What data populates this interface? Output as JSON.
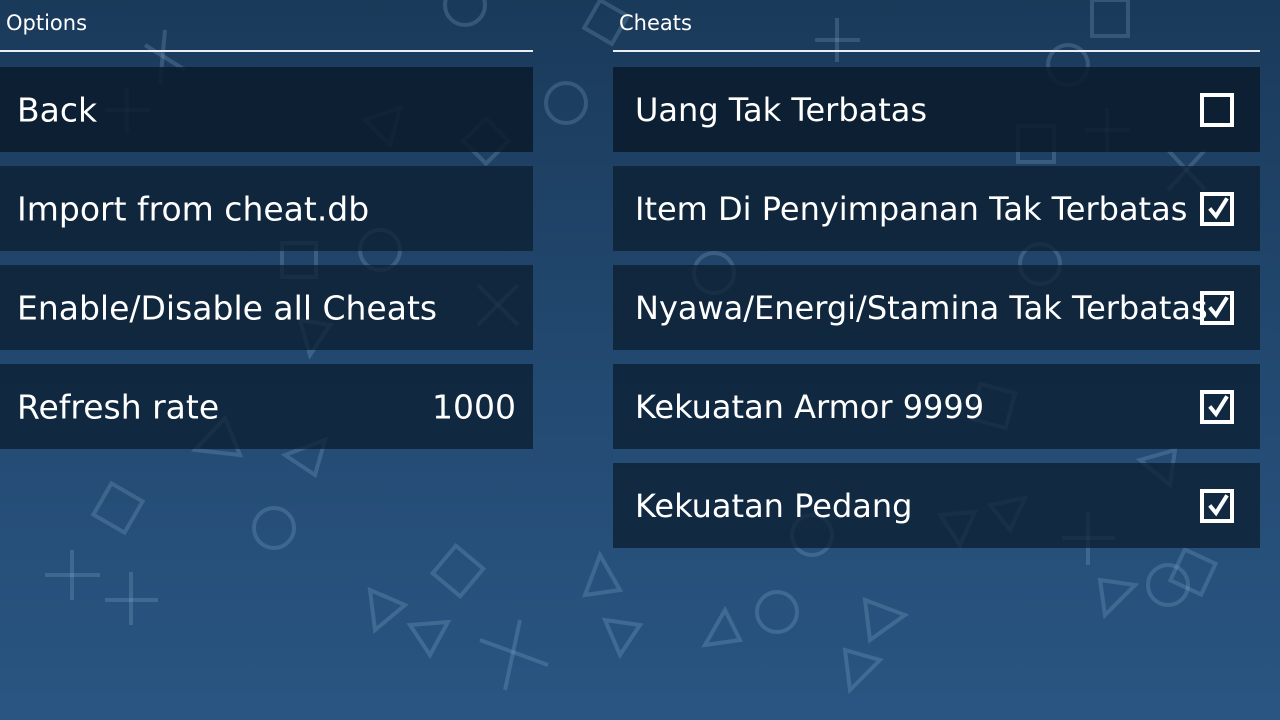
{
  "options": {
    "header": "Options",
    "items": [
      {
        "label": "Back"
      },
      {
        "label": "Import from cheat.db"
      },
      {
        "label": "Enable/Disable all Cheats"
      },
      {
        "label": "Refresh rate",
        "value": "1000"
      }
    ]
  },
  "cheats": {
    "header": "Cheats",
    "items": [
      {
        "label": "Uang Tak Terbatas",
        "checked": false
      },
      {
        "label": "Item Di Penyimpanan Tak Terbatas",
        "checked": true
      },
      {
        "label": "Nyawa/Energi/Stamina Tak Terbatas",
        "checked": true
      },
      {
        "label": "Kekuatan Armor 9999",
        "checked": true
      },
      {
        "label": "Kekuatan Pedang",
        "checked": true
      }
    ]
  },
  "colors": {
    "background_top": "#1a3a5a",
    "background_bottom": "#2a5582",
    "item_background": "#0a1c2d",
    "text": "#ffffff"
  },
  "icons": {
    "background_symbols": [
      "circle-icon",
      "cross-icon",
      "square-icon",
      "triangle-icon"
    ],
    "checkbox_checked": "checkbox-checked-icon",
    "checkbox_unchecked": "checkbox-unchecked-icon"
  }
}
